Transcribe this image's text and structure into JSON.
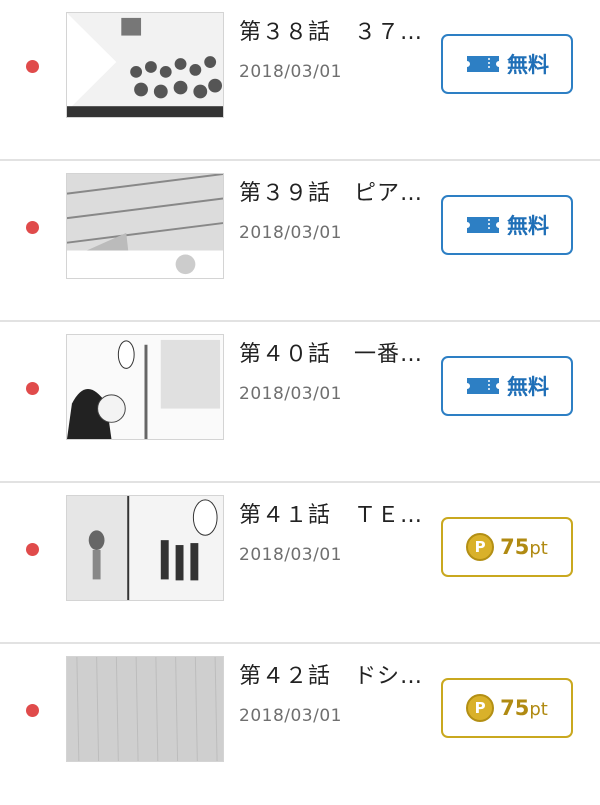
{
  "episodes": [
    {
      "title": "第３８話　３７…",
      "date": "2018/03/01",
      "price_type": "free",
      "label": "無料"
    },
    {
      "title": "第３９話　ピア…",
      "date": "2018/03/01",
      "price_type": "free",
      "label": "無料"
    },
    {
      "title": "第４０話　一番…",
      "date": "2018/03/01",
      "price_type": "free",
      "label": "無料"
    },
    {
      "title": "第４１話　ＴＥ…",
      "date": "2018/03/01",
      "price_type": "paid",
      "points": "75",
      "unit": "pt"
    },
    {
      "title": "第４２話　ドシ…",
      "date": "2018/03/01",
      "price_type": "paid",
      "points": "75",
      "unit": "pt"
    }
  ],
  "icons": {
    "unread": "unread-dot-icon",
    "free": "ticket-icon",
    "paid": "point-coin-icon"
  },
  "colors": {
    "unread_dot": "#e04b4b",
    "free_accent": "#2d7fc4",
    "paid_accent": "#c9a81f"
  }
}
